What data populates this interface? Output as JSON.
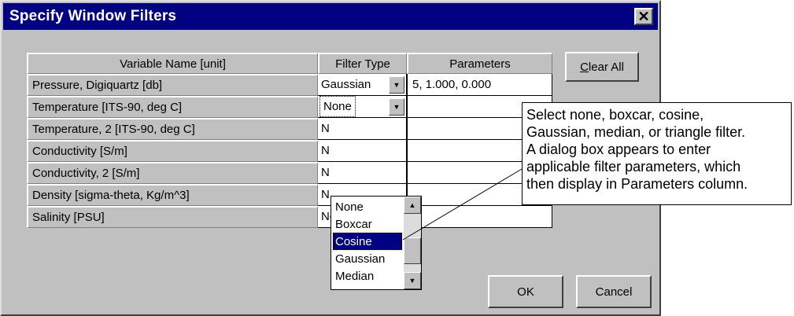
{
  "dialog": {
    "title": "Specify Window Filters",
    "close_symbol": "✕"
  },
  "table": {
    "headers": [
      "Variable Name [unit]",
      "Filter Type",
      "Parameters"
    ],
    "rows": [
      {
        "variable": "Pressure, Digiquartz [db]",
        "filter": "Gaussian",
        "params": "5, 1.000, 0.000"
      },
      {
        "variable": "Temperature [ITS-90, deg C]",
        "filter": "None",
        "params": ""
      },
      {
        "variable": "Temperature, 2 [ITS-90, deg C]",
        "filter": "N",
        "params": ""
      },
      {
        "variable": "Conductivity [S/m]",
        "filter": "N",
        "params": ""
      },
      {
        "variable": "Conductivity, 2 [S/m]",
        "filter": "N",
        "params": ""
      },
      {
        "variable": "Density [sigma-theta, Kg/m^3]",
        "filter": "N",
        "params": ""
      },
      {
        "variable": "Salinity [PSU]",
        "filter": "None",
        "params": ""
      }
    ]
  },
  "dropdown": {
    "options": [
      "None",
      "Boxcar",
      "Cosine",
      "Gaussian",
      "Median"
    ],
    "selected": "Cosine"
  },
  "buttons": {
    "clear_all_underlined": "C",
    "clear_all_rest": "lear All",
    "ok": "OK",
    "cancel": "Cancel"
  },
  "callout": {
    "lines": [
      "Select none, boxcar, cosine,",
      "Gaussian, median, or triangle filter.",
      "A dialog box appears to enter",
      "applicable filter parameters, which",
      "then display in Parameters column."
    ]
  },
  "icons": {
    "dropdown_arrow": "▼",
    "scroll_up": "▲",
    "scroll_down": "▼"
  }
}
